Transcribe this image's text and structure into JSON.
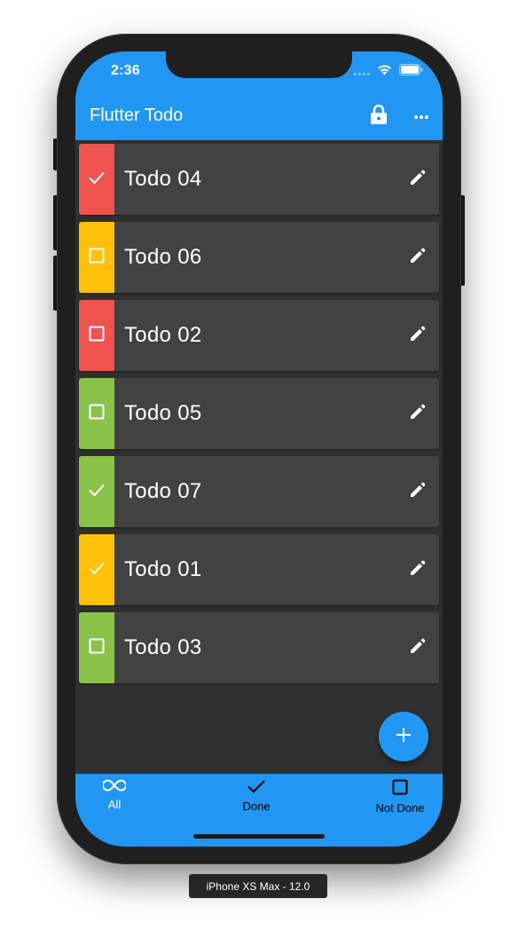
{
  "status_bar": {
    "time": "2:36"
  },
  "app_bar": {
    "title": "Flutter Todo",
    "actions": [
      "lock-icon",
      "more-horiz-icon"
    ]
  },
  "todos": [
    {
      "label": "Todo 04",
      "done": true,
      "color": "#ef5350"
    },
    {
      "label": "Todo 06",
      "done": false,
      "color": "#ffc107"
    },
    {
      "label": "Todo 02",
      "done": false,
      "color": "#ef5350"
    },
    {
      "label": "Todo 05",
      "done": false,
      "color": "#8bc34a"
    },
    {
      "label": "Todo 07",
      "done": true,
      "color": "#8bc34a"
    },
    {
      "label": "Todo 01",
      "done": true,
      "color": "#ffc107"
    },
    {
      "label": "Todo 03",
      "done": false,
      "color": "#8bc34a"
    }
  ],
  "fab": {
    "icon": "add-icon"
  },
  "bottom_nav": {
    "items": [
      {
        "label": "All",
        "icon": "all-inclusive-icon"
      },
      {
        "label": "Done",
        "icon": "check-icon"
      },
      {
        "label": "Not Done",
        "icon": "check-box-outline-icon"
      }
    ]
  },
  "simulator": {
    "label": "iPhone XS Max - 12.0"
  },
  "colors": {
    "primary": "#2196f3",
    "background": "#303030",
    "card": "#424242",
    "red": "#ef5350",
    "amber": "#ffc107",
    "green": "#8bc34a"
  }
}
